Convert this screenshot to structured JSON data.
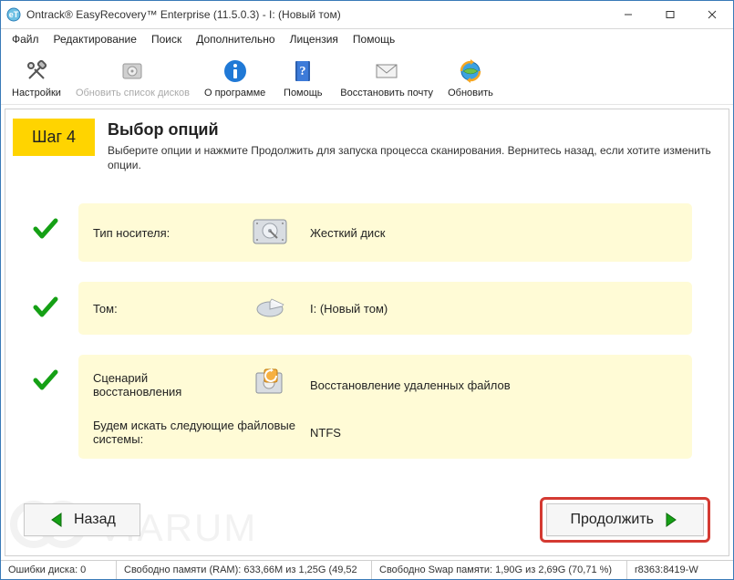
{
  "window": {
    "title": "Ontrack® EasyRecovery™ Enterprise (11.5.0.3) - I: (Новый том)"
  },
  "menu": {
    "file": "Файл",
    "edit": "Редактирование",
    "search": "Поиск",
    "extra": "Дополнительно",
    "license": "Лицензия",
    "help": "Помощь"
  },
  "toolbar": {
    "settings": "Настройки",
    "refresh_disks": "Обновить список дисков",
    "about": "О программе",
    "help": "Помощь",
    "recover_mail": "Восстановить почту",
    "update": "Обновить"
  },
  "step": {
    "chip": "Шаг 4",
    "title": "Выбор опций",
    "desc": "Выберите опции и нажмите Продолжить для запуска процесса сканирования. Вернитесь назад, если хотите изменить опции."
  },
  "options": {
    "media_label": "Тип носителя:",
    "media_value": "Жесткий диск",
    "volume_label": "Том:",
    "volume_value": "I: (Новый том)",
    "scenario_label": "Сценарий восстановления",
    "scenario_value": "Восстановление удаленных файлов",
    "fs_label": "Будем искать следующие файловые системы:",
    "fs_value": "NTFS"
  },
  "nav": {
    "back": "Назад",
    "next": "Продолжить"
  },
  "status": {
    "disk_errors": "Ошибки диска: 0",
    "ram": "Свободно памяти (RAM): 633,66M из 1,25G (49,52",
    "swap": "Свободно Swap памяти: 1,90G из 2,69G (70,71 %)",
    "build": "r8363:8419-W"
  },
  "watermark": "VIARUM"
}
